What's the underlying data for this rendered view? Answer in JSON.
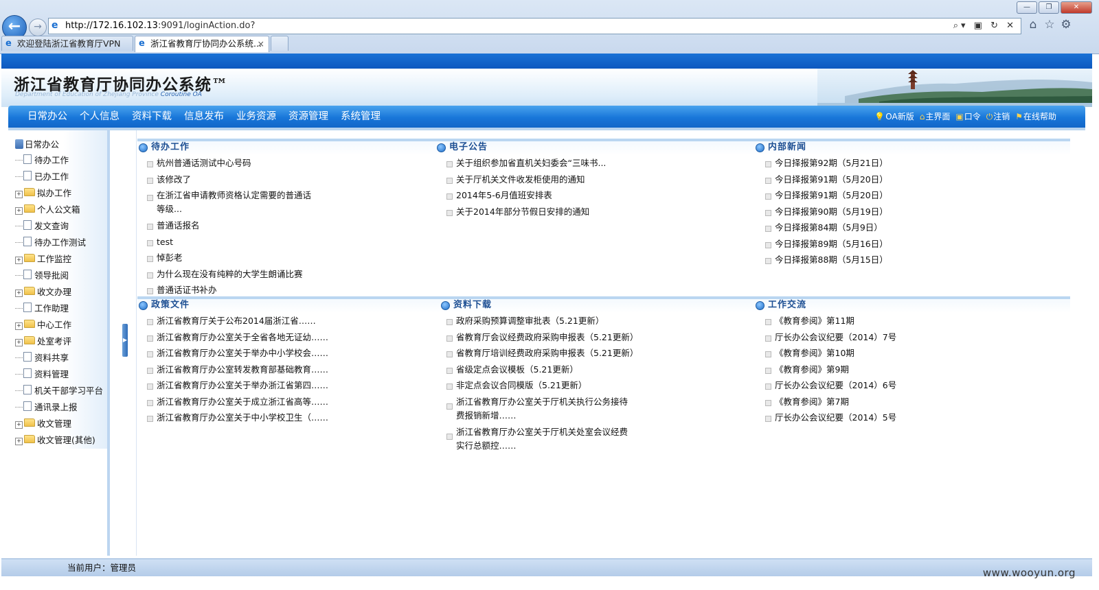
{
  "browser": {
    "url_host": "http://172.16.102.13",
    "url_path": ":9091/loginAction.do?",
    "tools": "⌕▾ ▣ ↻ ✕",
    "tabs": [
      {
        "label": "欢迎登陆浙江省教育厅VPN",
        "active": false
      },
      {
        "label": "浙江省教育厅协同办公系统...",
        "active": true
      }
    ],
    "window_buttons": [
      "—",
      "❐",
      "✕"
    ]
  },
  "app": {
    "title": "浙江省教育厅协同办公系统™",
    "subtitle": "Department of Education of Zhejiang Province",
    "subtitle_oa": "Coroutine OA"
  },
  "menu": {
    "items": [
      "日常办公",
      "个人信息",
      "资料下载",
      "信息发布",
      "业务资源",
      "资源管理",
      "系统管理"
    ],
    "right_links": [
      {
        "icon": "bulb-icon",
        "glyph": "💡",
        "label": "OA新版"
      },
      {
        "icon": "home-icon",
        "glyph": "⌂",
        "label": "主界面"
      },
      {
        "icon": "key-icon",
        "glyph": "▣",
        "label": "口令"
      },
      {
        "icon": "power-icon",
        "glyph": "⏻",
        "label": "注销"
      },
      {
        "icon": "flag-icon",
        "glyph": "⚑",
        "label": "在线帮助"
      }
    ]
  },
  "sidebar": {
    "root": "日常办公",
    "items": [
      {
        "label": "待办工作",
        "type": "doc"
      },
      {
        "label": "已办工作",
        "type": "doc"
      },
      {
        "label": "拟办工作",
        "type": "folder"
      },
      {
        "label": "个人公文箱",
        "type": "folder"
      },
      {
        "label": "发文查询",
        "type": "doc"
      },
      {
        "label": "待办工作测试",
        "type": "doc"
      },
      {
        "label": "工作监控",
        "type": "folder"
      },
      {
        "label": "领导批阅",
        "type": "doc"
      },
      {
        "label": "收文办理",
        "type": "folder"
      },
      {
        "label": "工作助理",
        "type": "doc"
      },
      {
        "label": "中心工作",
        "type": "folder"
      },
      {
        "label": "处室考评",
        "type": "folder"
      },
      {
        "label": "资料共享",
        "type": "doc"
      },
      {
        "label": "资料管理",
        "type": "doc"
      },
      {
        "label": "机关干部学习平台",
        "type": "doc"
      },
      {
        "label": "通讯录上报",
        "type": "doc"
      },
      {
        "label": "收文管理",
        "type": "folder"
      },
      {
        "label": "收文管理(其他)",
        "type": "folder"
      }
    ]
  },
  "portlets": {
    "todo": {
      "title": "待办工作",
      "items": [
        "杭州普通话测试中心号码",
        "该修改了",
        "在浙江省申请教师资格认定需要的普通话等级...",
        "普通话报名",
        "test",
        "悼彭老",
        "为什么现在没有纯粹的大学生朗诵比赛",
        "普通话证书补办"
      ]
    },
    "notice": {
      "title": "电子公告",
      "items": [
        "关于组织参加省直机关妇委会“三味书...",
        "关于厅机关文件收发柜使用的通知",
        "2014年5-6月值班安排表",
        "关于2014年部分节假日安排的通知"
      ]
    },
    "news": {
      "title": "内部新闻",
      "items": [
        "今日择报第92期（5月21日）",
        "今日择报第91期（5月20日）",
        "今日择报第91期（5月20日）",
        "今日择报第90期（5月19日）",
        "今日择报第84期（5月9日）",
        "今日择报第89期（5月16日）",
        "今日择报第88期（5月15日）"
      ]
    },
    "policy": {
      "title": "政策文件",
      "items": [
        "浙江省教育厅关于公布2014届浙江省……",
        "浙江省教育厅办公室关于全省各地无证幼……",
        "浙江省教育厅办公室关于举办中小学校会……",
        "浙江省教育厅办公室转发教育部基础教育……",
        "浙江省教育厅办公室关于举办浙江省第四……",
        "浙江省教育厅办公室关于成立浙江省高等……",
        "浙江省教育厅办公室关于中小学校卫生（……"
      ]
    },
    "download": {
      "title": "资料下载",
      "items": [
        "政府采购预算调整审批表（5.21更新）",
        "省教育厅会议经费政府采购申报表（5.21更新）",
        "省教育厅培训经费政府采购申报表（5.21更新）",
        "省级定点会议模板（5.21更新）",
        "非定点会议合同模版（5.21更新）",
        "浙江省教育厅办公室关于厅机关执行公务接待费报销新增……",
        "浙江省教育厅办公室关于厅机关处室会议经费实行总额控……"
      ]
    },
    "exchange": {
      "title": "工作交流",
      "items": [
        "《教育参阅》第11期",
        "厅长办公会议纪要（2014）7号",
        "《教育参阅》第10期",
        "《教育参阅》第9期",
        "厅长办公会议纪要（2014）6号",
        "《教育参阅》第7期",
        "厅长办公会议纪要（2014）5号"
      ]
    }
  },
  "status": {
    "current_user": "当前用户：管理员",
    "watermark": "www.wooyun.org"
  },
  "colors": {
    "accent_blue": "#1876d9",
    "portlet_title": "#1d4f93"
  }
}
